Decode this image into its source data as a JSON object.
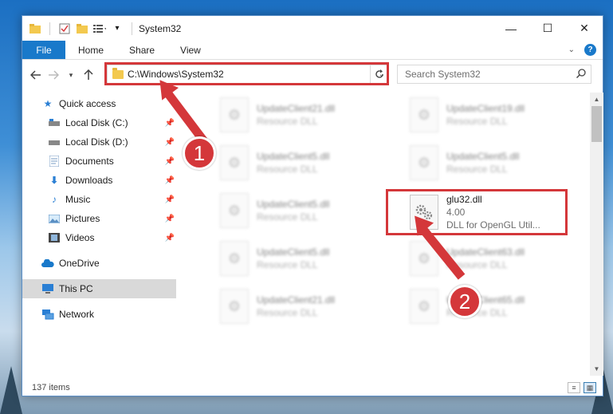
{
  "window": {
    "title": "System32",
    "controls": {
      "minimize": "—",
      "maximize": "☐",
      "close": "✕"
    }
  },
  "ribbon": {
    "file_label": "File",
    "tabs": [
      "Home",
      "Share",
      "View"
    ],
    "help_label": "?"
  },
  "navbar": {
    "address": "C:\\Windows\\System32",
    "search_placeholder": "Search System32"
  },
  "sidebar": {
    "items": [
      {
        "label": "Quick access",
        "icon": "star-icon",
        "pinned": false
      },
      {
        "label": "Local Disk (C:)",
        "icon": "drive-icon",
        "pinned": true
      },
      {
        "label": "Local Disk (D:)",
        "icon": "drive-icon",
        "pinned": true
      },
      {
        "label": "Documents",
        "icon": "documents-icon",
        "pinned": true
      },
      {
        "label": "Downloads",
        "icon": "download-icon",
        "pinned": true
      },
      {
        "label": "Music",
        "icon": "music-icon",
        "pinned": true
      },
      {
        "label": "Pictures",
        "icon": "pictures-icon",
        "pinned": true
      },
      {
        "label": "Videos",
        "icon": "videos-icon",
        "pinned": true
      },
      {
        "label": "OneDrive",
        "icon": "cloud-icon",
        "pinned": false
      },
      {
        "label": "This PC",
        "icon": "computer-icon",
        "pinned": false,
        "selected": true
      },
      {
        "label": "Network",
        "icon": "network-icon",
        "pinned": false
      }
    ]
  },
  "files": [
    {
      "name": "UpdateClient21.dll",
      "line2": "Resource DLL",
      "blurred": true
    },
    {
      "name": "UpdateClient19.dll",
      "line2": "Resource DLL",
      "blurred": true
    },
    {
      "name": "UpdateClient5.dll",
      "line2": "Resource DLL",
      "blurred": true
    },
    {
      "name": "UpdateClient5.dll",
      "line2": "Resource DLL",
      "blurred": true
    },
    {
      "name": "UpdateClient5.dll",
      "line2": "Resource DLL",
      "blurred": true
    },
    {
      "name": "glu32.dll",
      "line2": "4.00",
      "line3": "DLL for OpenGL Util...",
      "blurred": false
    },
    {
      "name": "UpdateClient5.dll",
      "line2": "Resource DLL",
      "blurred": true
    },
    {
      "name": "UpdateClient63.dll",
      "line2": "Resource DLL",
      "blurred": true
    },
    {
      "name": "UpdateClient21.dll",
      "line2": "Resource DLL",
      "blurred": true
    },
    {
      "name": "UpdateClient65.dll",
      "line2": "Resource DLL",
      "blurred": true
    }
  ],
  "status": {
    "count": "137 items"
  },
  "callouts": {
    "step1": "1",
    "step2": "2"
  },
  "colors": {
    "accent": "#1979ca",
    "highlight": "#d4373a",
    "selected": "#d9d9d9"
  }
}
